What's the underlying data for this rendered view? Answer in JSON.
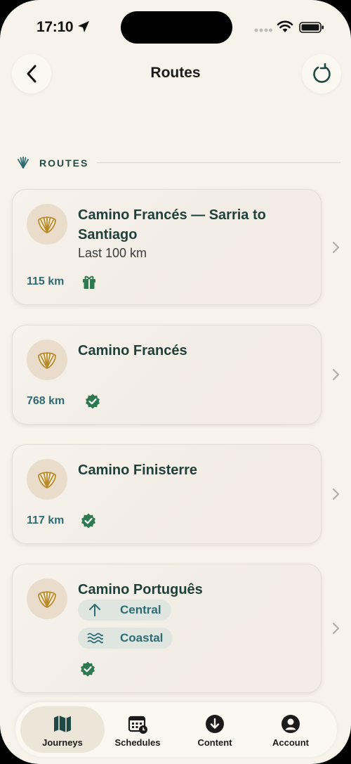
{
  "status": {
    "time": "17:10"
  },
  "nav": {
    "title": "Routes"
  },
  "section": {
    "label": "ROUTES"
  },
  "routes": [
    {
      "title": "Camino Francés — Sarria to Santiago",
      "subtitle": "Last 100 km",
      "distance": "115 km",
      "status_icon": "gift-icon"
    },
    {
      "title": "Camino Francés",
      "distance": "768 km",
      "status_icon": "verified-icon"
    },
    {
      "title": "Camino Finisterre",
      "distance": "117 km",
      "status_icon": "verified-icon"
    },
    {
      "title": "Camino Português",
      "variants": [
        "Central",
        "Coastal"
      ],
      "status_icon": "verified-icon"
    }
  ],
  "tabs": [
    {
      "label": "Journeys",
      "icon": "map-icon",
      "active": true
    },
    {
      "label": "Schedules",
      "icon": "calendar-clock-icon"
    },
    {
      "label": "Content",
      "icon": "download-icon"
    },
    {
      "label": "Account",
      "icon": "account-icon"
    }
  ],
  "colors": {
    "background": "#f7f2ea",
    "accent": "#1f3f3a",
    "distance": "#2f6a73",
    "verified": "#2e7a50",
    "shell": "#b98a2a"
  }
}
